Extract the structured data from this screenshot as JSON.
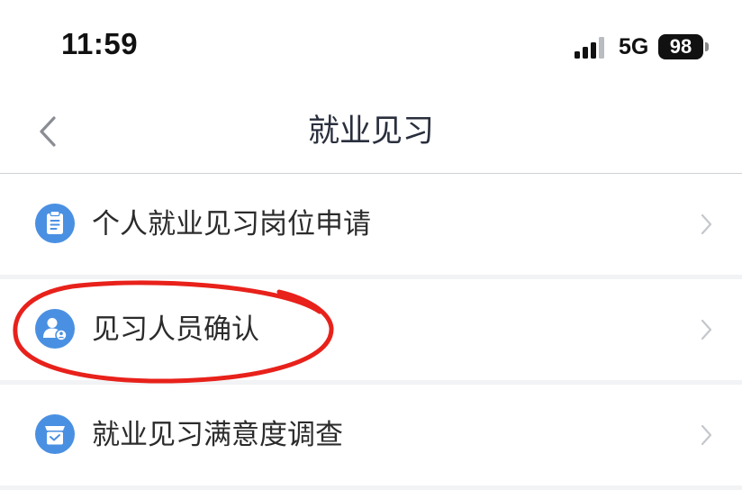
{
  "status_bar": {
    "time": "11:59",
    "network": "5G",
    "battery": "98"
  },
  "nav": {
    "title": "就业见习"
  },
  "menu": {
    "items": [
      {
        "label": "个人就业见习岗位申请",
        "icon": "clipboard-icon"
      },
      {
        "label": "见习人员确认",
        "icon": "user-confirm-icon"
      },
      {
        "label": "就业见习满意度调查",
        "icon": "survey-box-icon"
      }
    ]
  },
  "colors": {
    "icon_blue": "#4a90e2",
    "highlight_red": "#e8211b",
    "chevron_gray": "#c4c7cc"
  }
}
